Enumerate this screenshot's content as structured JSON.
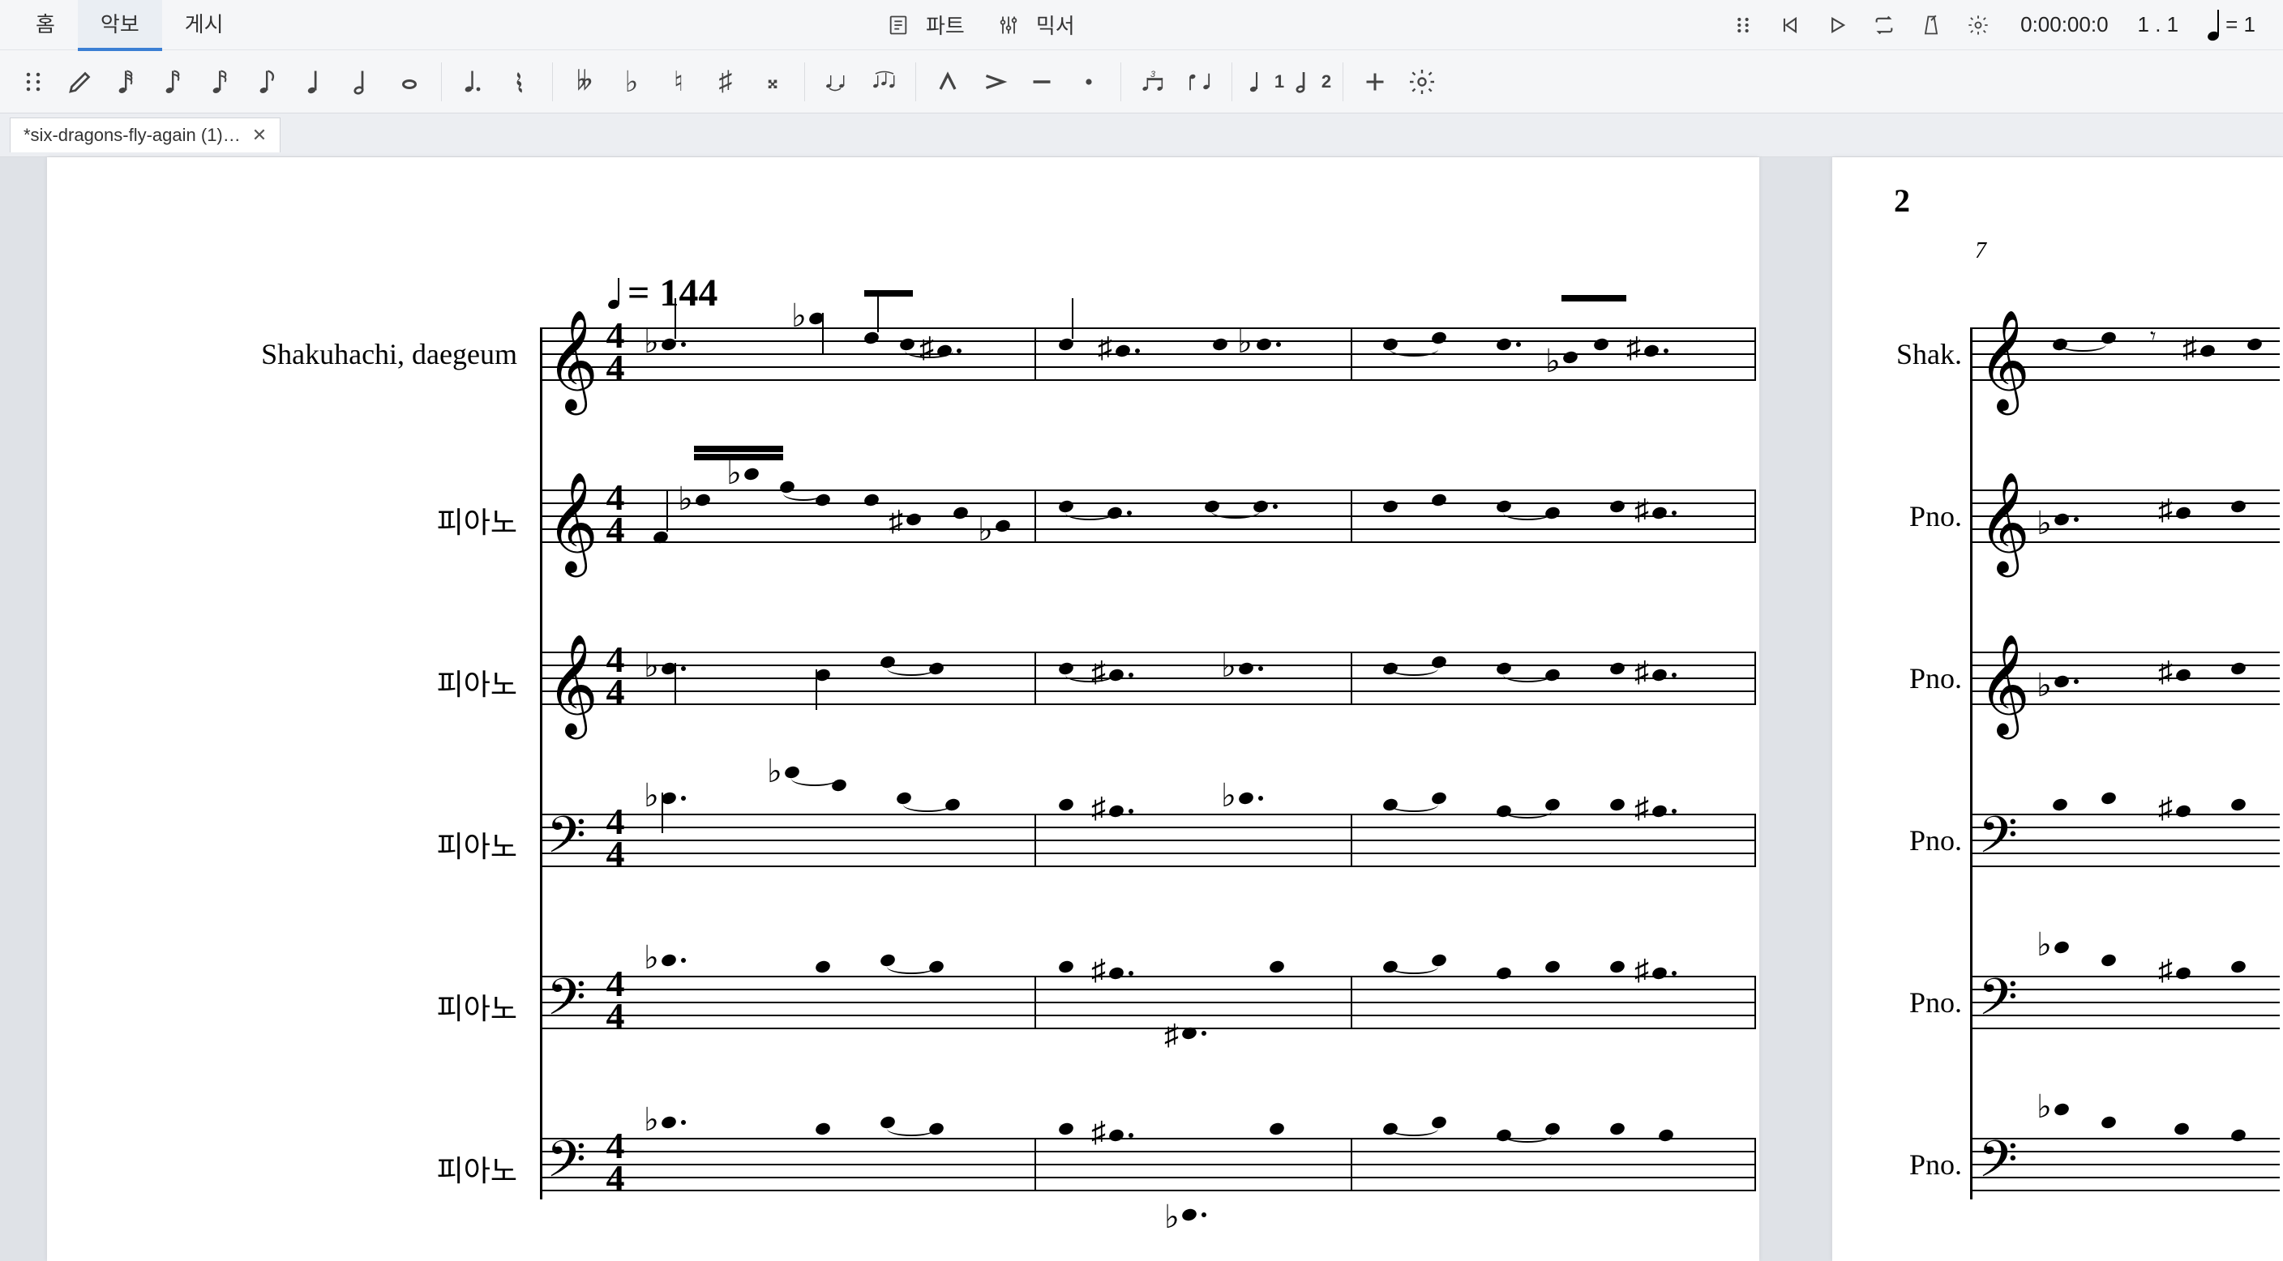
{
  "menubar": {
    "tabs": [
      "홈",
      "악보",
      "게시"
    ],
    "active_index": 1,
    "part_label": "파트",
    "mixer_label": "믹서",
    "time_counter": "0:00:00:0",
    "position_counter": "1 . 1",
    "tempo_display": "= 1"
  },
  "toolbar": {
    "groups": [
      [
        "drag-handle",
        "pencil",
        "note-64",
        "note-32",
        "note-16",
        "note-8",
        "note-quarter",
        "note-half",
        "note-whole"
      ],
      [
        "note-dotted",
        "rest"
      ],
      [
        "double-flat",
        "flat",
        "natural",
        "sharp",
        "double-sharp"
      ],
      [
        "tie",
        "slur"
      ],
      [
        "marcato",
        "accent",
        "tenuto",
        "staccato"
      ],
      [
        "tuplet",
        "flip"
      ],
      [
        "voice-1",
        "voice-2"
      ],
      [
        "add",
        "settings"
      ]
    ],
    "voice1_label": "1",
    "voice2_label": "2"
  },
  "doctab": {
    "title": "*six-dragons-fly-again (1)…"
  },
  "score": {
    "tempo_mark": "= 144",
    "time_signature": {
      "num": "4",
      "den": "4"
    },
    "page2_number": "2",
    "page2_rehearsal": "7",
    "instruments_page1": [
      "Shakuhachi, daegeum",
      "피아노",
      "피아노",
      "피아노",
      "피아노",
      "피아노"
    ],
    "instruments_page2": [
      "Shak.",
      "Pno.",
      "Pno.",
      "Pno.",
      "Pno.",
      "Pno."
    ],
    "clefs": [
      "treble",
      "treble",
      "treble",
      "bass",
      "bass",
      "bass"
    ]
  }
}
